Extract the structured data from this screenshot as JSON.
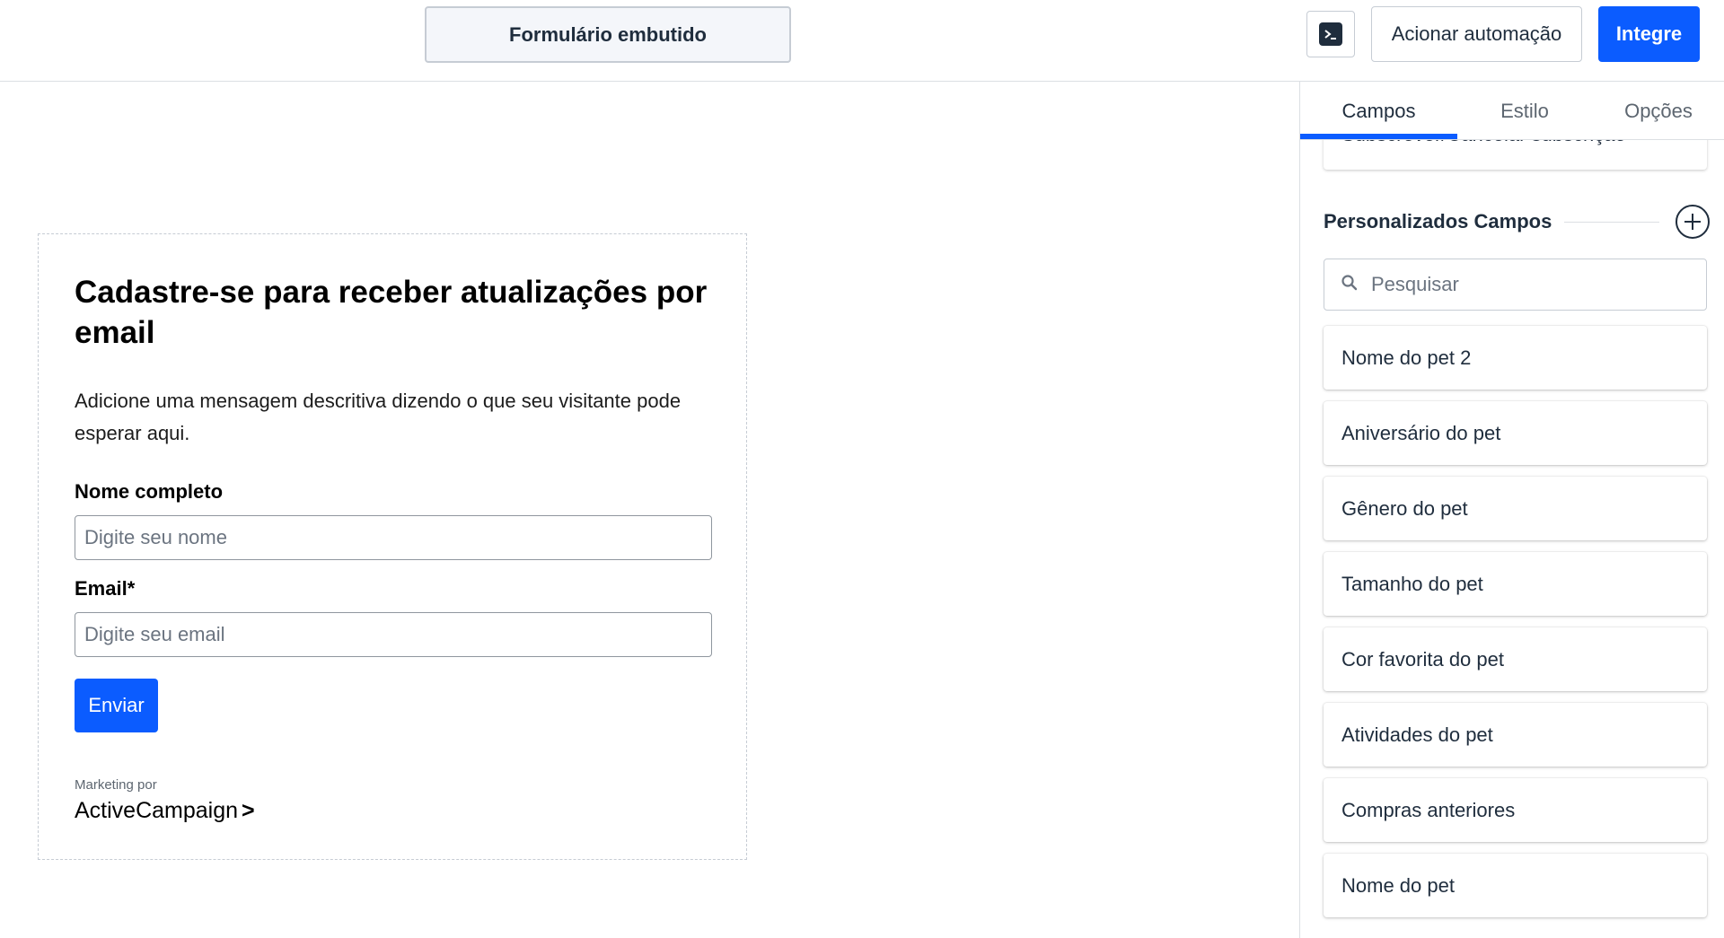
{
  "topbar": {
    "form_type": "Formulário embutido",
    "terminal_icon": "terminal-icon",
    "automation_label": "Acionar automação",
    "integrate_label": "Integre",
    "accent_color": "#0b5cff"
  },
  "form": {
    "title": "Cadastre-se para receber atualizações por email",
    "description": "Adicione uma mensagem descritiva dizendo o que seu visitante pode esperar aqui.",
    "fields": [
      {
        "label": "Nome completo",
        "placeholder": "Digite seu nome"
      },
      {
        "label": "Email*",
        "placeholder": "Digite seu email"
      }
    ],
    "submit_label": "Enviar",
    "marketing_by": "Marketing por",
    "brand": "ActiveCampaign",
    "brand_arrow": ">"
  },
  "panel": {
    "tabs": [
      {
        "label": "Campos",
        "active": true
      },
      {
        "label": "Estilo",
        "active": false
      },
      {
        "label": "Opções",
        "active": false
      }
    ],
    "partial_field": "Subscrever/Cancelar subscrição",
    "section_title": "Personalizados Campos",
    "add_icon": "plus-circle-icon",
    "search_placeholder": "Pesquisar",
    "search_icon": "search-icon",
    "custom_fields": [
      "Nome do pet 2",
      "Aniversário do pet",
      "Gênero do pet",
      "Tamanho do pet",
      "Cor favorita do pet",
      "Atividades do pet",
      "Compras anteriores",
      "Nome do pet"
    ]
  }
}
